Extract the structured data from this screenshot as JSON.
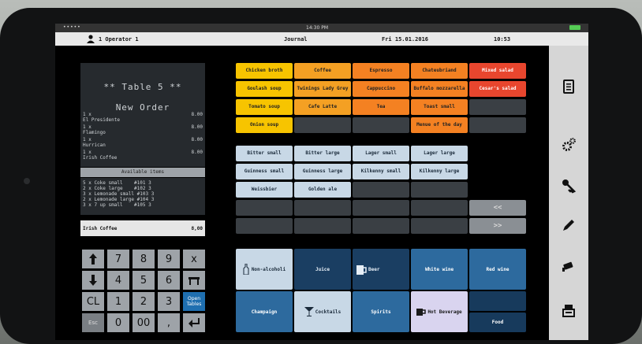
{
  "status": {
    "signal": "•••••",
    "time": "14:30 PM"
  },
  "header": {
    "operator": "1  Operator 1",
    "module": "Journal",
    "date": "Fri 15.01.2016",
    "clock": "10:53"
  },
  "receipt": {
    "title": "** Table 5 **",
    "subtitle": "New Order",
    "lines": [
      {
        "qty": "1 x",
        "price": "8.00",
        "name": "El Presidente"
      },
      {
        "qty": "1 x",
        "price": "8.00",
        "name": "Flamingo"
      },
      {
        "qty": "1 x",
        "price": "8.00",
        "name": "Hurrican"
      },
      {
        "qty": "1 x",
        "price": "8.00",
        "name": "Irish Coffee"
      }
    ]
  },
  "available": {
    "header": "Available items",
    "items": [
      "5 x Coke small    #101 3",
      "2 x Coke large    #102 3",
      "3 x Lemonade small #103 3",
      "2 x Lemonade large #104 3",
      "3 x 7 up small    #105 3"
    ]
  },
  "selected": {
    "name": "Irish Coffee",
    "price": "8,00"
  },
  "keypad": {
    "k7": "7",
    "k8": "8",
    "k9": "9",
    "kx": "x",
    "k4": "4",
    "k5": "5",
    "k6": "6",
    "kcl": "CL",
    "k1": "1",
    "k2": "2",
    "k3": "3",
    "open": "Open Tables",
    "esc": "Esc",
    "k0": "0",
    "k00": "00",
    "kdot": ","
  },
  "products": {
    "row1": [
      "Chicken broth",
      "Coffee",
      "Espresso",
      "Chateubriand",
      "Mixed salad"
    ],
    "row2": [
      "Goulash soup",
      "Twinings Lady Grey",
      "Cappuccino",
      "Buffalo mozzarella",
      "Cesar's salad"
    ],
    "row3": [
      "Tomato soup",
      "Cafe Latte",
      "Tea",
      "Toast small"
    ],
    "row4": [
      "Onion soup",
      "Menue of the day"
    ],
    "row5": [
      "Bitter small",
      "Bitter large",
      "Lager small",
      "Lager large"
    ],
    "row6": [
      "Guinness small",
      "Guinness large",
      "Kilkenny small",
      "Kilkenny large"
    ],
    "row7": [
      "Weissbier",
      "Golden ale"
    ],
    "nav_prev": "<<",
    "nav_next": ">>"
  },
  "categories": {
    "non_alcoholic": "Non-alcoholi",
    "juice": "Juice",
    "beer": "Beer",
    "white_wine": "White wine",
    "red_wine": "Red wine",
    "champaign": "Champaign",
    "cocktails": "Cocktails",
    "spirits": "Spirits",
    "hot_beverage": "Hot Beverage",
    "food": "Food"
  },
  "sidebar_icons": [
    "receipt-icon",
    "settings-gears-icon",
    "key-icon",
    "pen-icon",
    "camera-icon",
    "cash-register-icon"
  ]
}
